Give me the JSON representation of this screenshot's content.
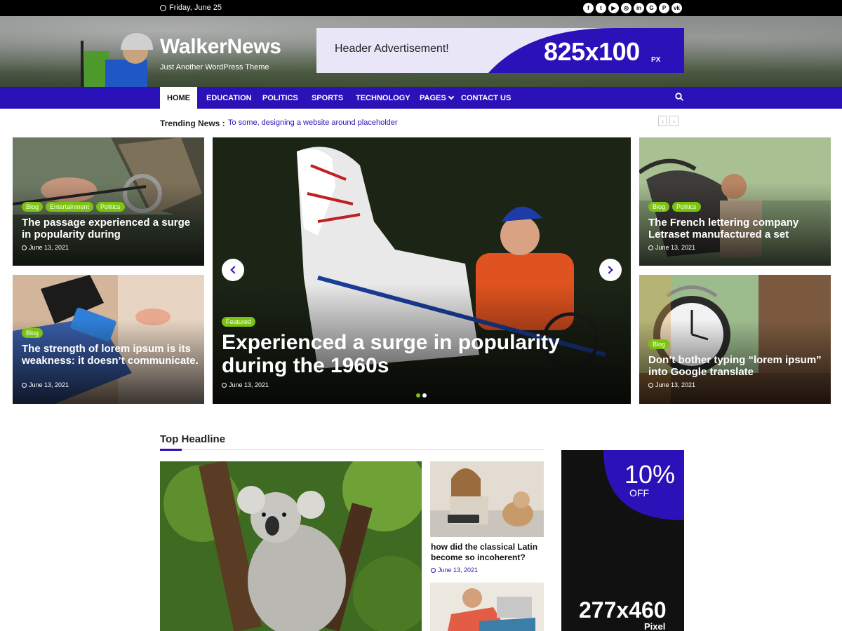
{
  "topbar": {
    "date": "Friday, June 25",
    "social_icons": [
      "facebook-icon",
      "twitter-icon",
      "youtube-icon",
      "instagram-icon",
      "linkedin-icon",
      "google-icon",
      "pinterest-icon",
      "vk-icon"
    ],
    "social_glyphs": [
      "f",
      "t",
      "▶",
      "◎",
      "in",
      "G",
      "P",
      "vk"
    ]
  },
  "header": {
    "site_title": "WalkerNews",
    "tagline": "Just Another WordPress Theme",
    "ad_label": "Header Advertisement!",
    "ad_size": "825x100",
    "ad_unit": "PX"
  },
  "nav": {
    "items": [
      "HOME",
      "EDUCATION",
      "POLITICS",
      "SPORTS",
      "TECHNOLOGY",
      "PAGES",
      "CONTACT US"
    ],
    "active": "HOME"
  },
  "trending": {
    "label": "Trending News :",
    "text": "To some, designing a website around placeholder",
    "prev": "‹",
    "next": "›"
  },
  "cards": {
    "left_top": {
      "tags": [
        "Blog",
        "Entertainment",
        "Politics"
      ],
      "title": "The passage experienced a surge in popularity during",
      "date": "June 13, 2021"
    },
    "left_bottom": {
      "tags": [
        "Blog"
      ],
      "title": "The strength of lorem ipsum is its weakness: it doesn’t communicate.",
      "date": "June 13, 2021"
    },
    "feature": {
      "tags": [
        "Featured"
      ],
      "title": "Experienced a surge in popularity during the 1960s",
      "date": "June 13, 2021",
      "slides": 2,
      "active_slide": 1
    },
    "right_top": {
      "tags": [
        "Blog",
        "Politics"
      ],
      "title": "The French lettering company Letraset manufactured a set",
      "date": "June 13, 2021"
    },
    "right_bottom": {
      "tags": [
        "Blog"
      ],
      "title": "Don’t bother typing “lorem ipsum” into Google translate",
      "date": "June 13, 2021"
    }
  },
  "top_headline": {
    "section_title": "Top Headline",
    "side_post_1": {
      "title": "how did the classical Latin become so incoherent?",
      "date": "June 13, 2021"
    }
  },
  "side_ad": {
    "discount": "10%",
    "off": "OFF",
    "size": "277x460",
    "unit": "Pixel"
  },
  "colors": {
    "brand_blue": "#2b11b8",
    "tag_green": "#7bc311",
    "topbar": "#000000"
  }
}
